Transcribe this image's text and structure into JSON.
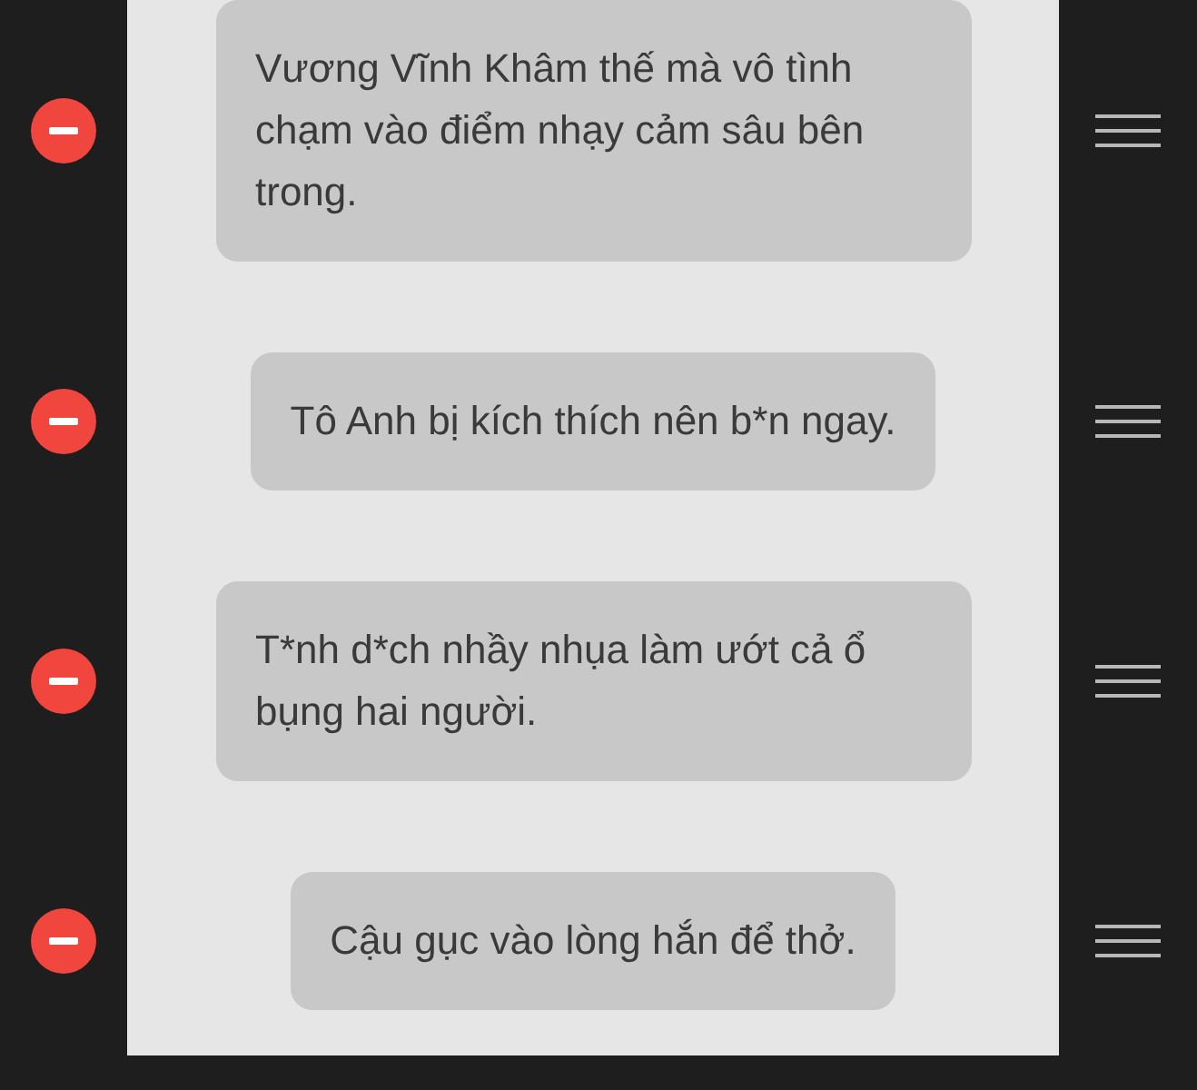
{
  "items": [
    {
      "text": "Vương Vĩnh Khâm thế mà vô tình chạm vào điểm nhạy cảm sâu bên trong."
    },
    {
      "text": "Tô Anh bị kích thích nên b*n ngay."
    },
    {
      "text": "T*nh d*ch nhầy nhụa làm ướt cả ổ bụng hai người."
    },
    {
      "text": "Cậu gục vào lòng hắn để thở."
    }
  ]
}
